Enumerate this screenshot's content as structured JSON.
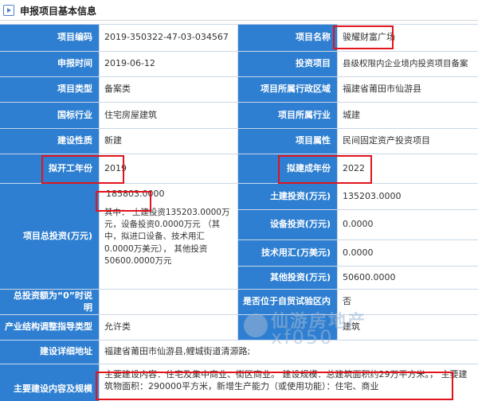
{
  "header": {
    "title": "申报项目基本信息"
  },
  "rows": {
    "code": {
      "label": "项目编码",
      "value": "2019-350322-47-03-034567"
    },
    "name": {
      "label": "项目名称",
      "value": "骏耀财富广场"
    },
    "apply_time": {
      "label": "申报时间",
      "value": "2019-06-12"
    },
    "invest_project": {
      "label": "投资项目",
      "value": "县级权限内企业境内投资项目备案"
    },
    "project_type": {
      "label": "项目类型",
      "value": "备案类"
    },
    "admin_region": {
      "label": "项目所属行政区域",
      "value": "福建省莆田市仙游县"
    },
    "national_industry": {
      "label": "国标行业",
      "value": "住宅房屋建筑"
    },
    "project_industry": {
      "label": "项目所属行业",
      "value": "城建"
    },
    "build_nature": {
      "label": "建设性质",
      "value": "新建"
    },
    "project_attr": {
      "label": "项目属性",
      "value": "民间固定资产投资项目"
    },
    "start_year": {
      "label": "拟开工年份",
      "value": "2019"
    },
    "finish_year": {
      "label": "拟建成年份",
      "value": "2022"
    },
    "total_invest": {
      "label": "项目总投资(万元)",
      "value": "185803.0000",
      "note": "其中： 土建投资135203.0000万元，设备投资0.0000万元 （其中，拟进口设备、技术用汇 0.0000万美元）， 其他投资50600.0000万元"
    },
    "civil_invest": {
      "label": "土建投资(万元)",
      "value": "135203.0000"
    },
    "equip_invest": {
      "label": "设备投资(万元)",
      "value": "0.0000"
    },
    "tech_fx": {
      "label": "技术用汇(万美元)",
      "value": "0.0000"
    },
    "other_invest": {
      "label": "其他投资(万元)",
      "value": "50600.0000"
    },
    "zero_reason": {
      "label": "总投资额为“0”时说明",
      "value": ""
    },
    "ftz": {
      "label": "是否位于自贸试验区内",
      "value": "否"
    },
    "industry_guide": {
      "label": "产业结构调整指导类型",
      "value": "允许类"
    },
    "industry_guide_right": {
      "label": "",
      "value": "建筑"
    },
    "address": {
      "label": "建设详细地址",
      "value": "福建省莆田市仙游县,鲤城街道清源路;"
    },
    "content": {
      "label": "主要建设内容及规模",
      "value": "主要建设内容：住宅及集中商业、街区商业。 建设规模：总建筑面积约29万平方米。， 主要建筑物面积：290000平方米，新增生产能力（或使用功能）：住宅、商业"
    }
  },
  "watermark": {
    "cn": "仙游房地产",
    "en": "xf050"
  },
  "colors": {
    "label_bg": "#2e7fd1",
    "highlight": "#e2141c",
    "grid_line": "#c9d7e8"
  }
}
